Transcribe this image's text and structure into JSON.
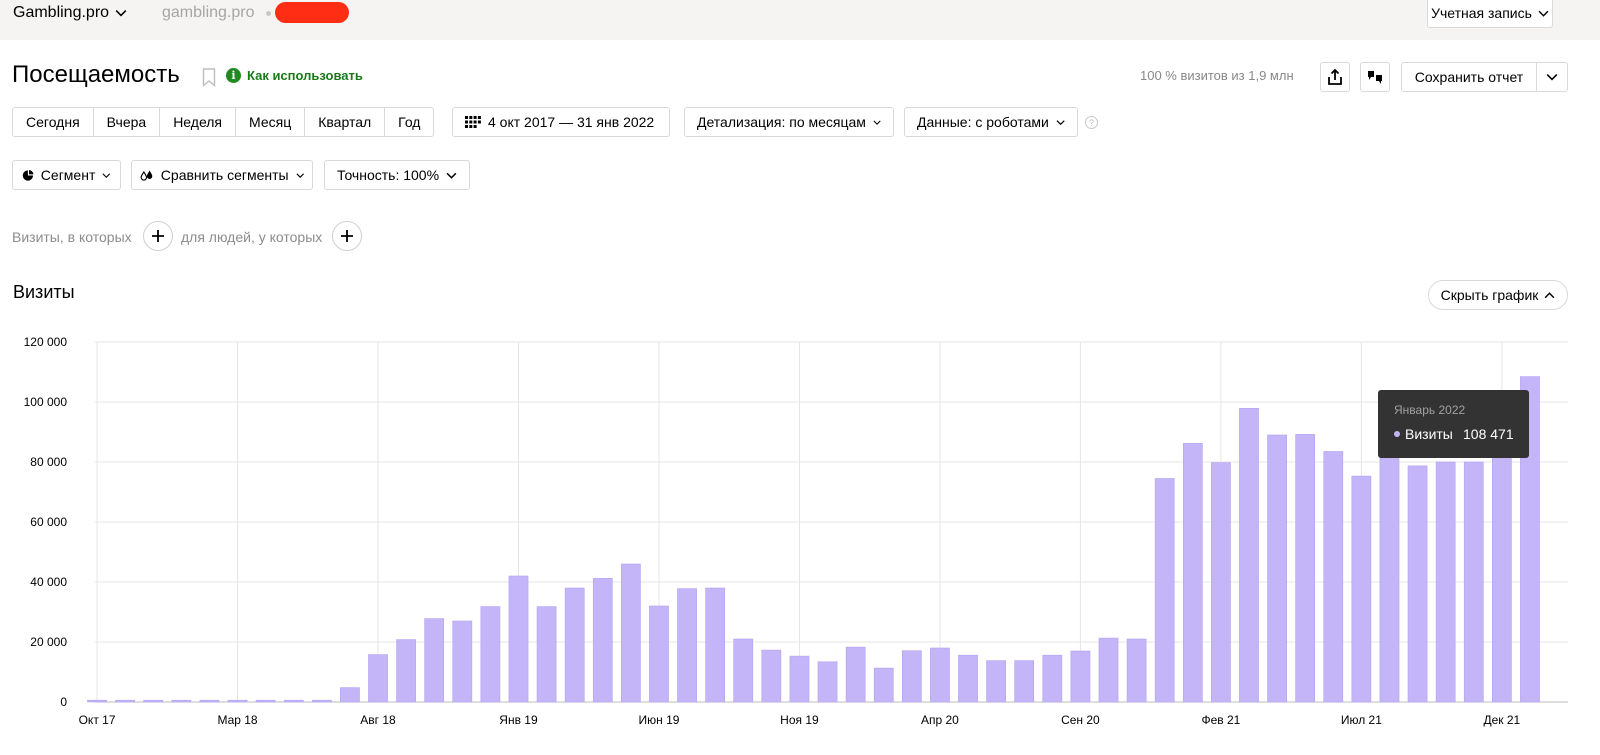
{
  "header": {
    "site_name": "Gambling.pro",
    "site_domain": "gambling.pro",
    "account_label": "Учетная запись"
  },
  "title": {
    "page_title": "Посещаемость",
    "how_to_use": "Как использовать",
    "visits_share": "100 % визитов из 1,9 млн",
    "save_report": "Сохранить отчет"
  },
  "filters": {
    "periods": [
      "Сегодня",
      "Вчера",
      "Неделя",
      "Месяц",
      "Квартал",
      "Год"
    ],
    "date_range": "4 окт 2017 — 31 янв 2022",
    "detail": "Детализация: по месяцам",
    "data_mode": "Данные: с роботами",
    "segment": "Сегмент",
    "compare_segments": "Сравнить сегменты",
    "accuracy": "Точность: 100%"
  },
  "conditions": {
    "visits_where": "Визиты, в которых",
    "people_where": "для людей, у которых"
  },
  "section": {
    "title": "Визиты",
    "hide_chart": "Скрыть график"
  },
  "tooltip": {
    "period": "Январь 2022",
    "series": "Визиты",
    "value": "108 471"
  },
  "colors": {
    "bar": "#c4b5f8",
    "bar_stroke": "#b4a2f0",
    "grid": "#e6e6e6",
    "tooltip_bg": "#333333",
    "link_green": "#1a7b1a"
  },
  "chart_data": {
    "type": "bar",
    "ylim": [
      0,
      120000
    ],
    "yticks": [
      0,
      20000,
      40000,
      60000,
      80000,
      100000,
      120000
    ],
    "ytick_labels": [
      "0",
      "20 000",
      "40 000",
      "60 000",
      "80 000",
      "100 000",
      "120 000"
    ],
    "xtick_labels": [
      {
        "index": 0,
        "label": "Окт 17"
      },
      {
        "index": 5,
        "label": "Мар 18"
      },
      {
        "index": 10,
        "label": "Авг 18"
      },
      {
        "index": 15,
        "label": "Янв 19"
      },
      {
        "index": 20,
        "label": "Июн 19"
      },
      {
        "index": 25,
        "label": "Ноя 19"
      },
      {
        "index": 30,
        "label": "Апр 20"
      },
      {
        "index": 35,
        "label": "Сен 20"
      },
      {
        "index": 40,
        "label": "Фев 21"
      },
      {
        "index": 45,
        "label": "Июл 21"
      },
      {
        "index": 50,
        "label": "Дек 21"
      }
    ],
    "series": [
      {
        "name": "Визиты",
        "values": [
          600,
          600,
          600,
          600,
          600,
          600,
          600,
          600,
          600,
          4800,
          15800,
          20800,
          27800,
          27000,
          31800,
          42000,
          31800,
          38000,
          41200,
          46000,
          32000,
          37800,
          38000,
          21000,
          17300,
          15300,
          13400,
          18300,
          11300,
          17100,
          18000,
          15600,
          13800,
          13800,
          15600,
          17000,
          21300,
          21000,
          74500,
          86200,
          79800,
          97900,
          89000,
          89200,
          83500,
          75300,
          84800,
          78700,
          80000,
          80000,
          82000,
          108471
        ]
      }
    ]
  }
}
